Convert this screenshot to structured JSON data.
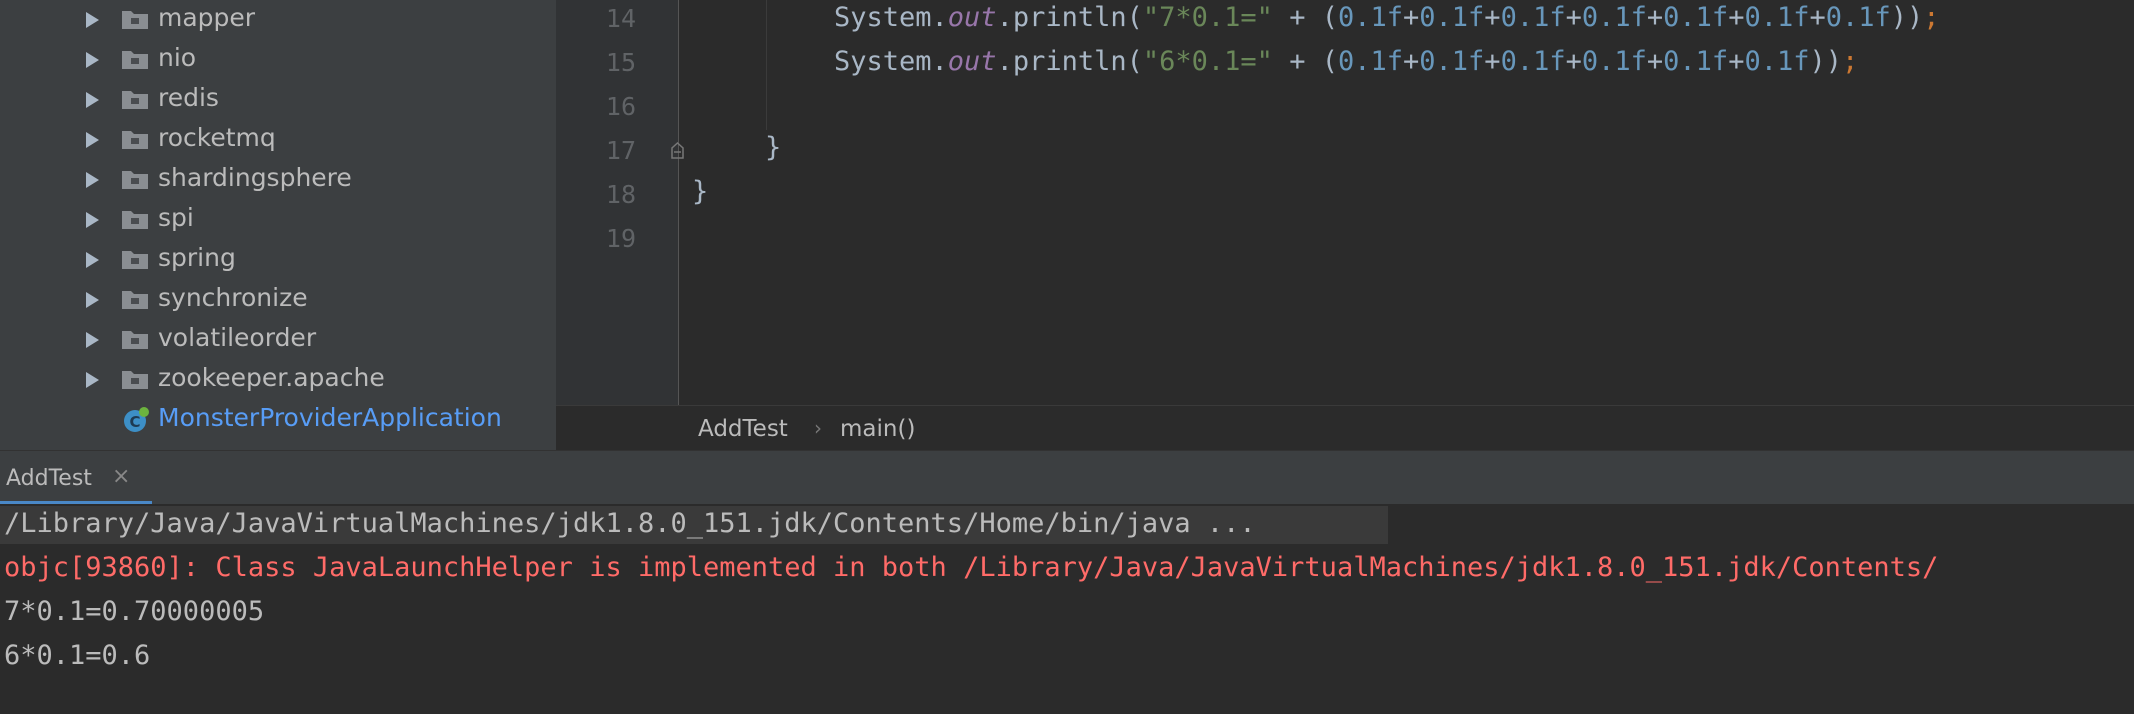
{
  "tree": {
    "folders": [
      "mapper",
      "nio",
      "redis",
      "rocketmq",
      "shardingsphere",
      "spi",
      "spring",
      "synchronize",
      "volatileorder",
      "zookeeper.apache"
    ],
    "app_class": "MonsterProviderApplication"
  },
  "editor": {
    "line_numbers": [
      "14",
      "15",
      "16",
      "17",
      "18",
      "19"
    ],
    "line14": {
      "prefix": "System.",
      "field": "out",
      "call": ".println(",
      "string": "\"7*0.1=\"",
      "plus": " + (",
      "nums": [
        "0.1f",
        "0.1f",
        "0.1f",
        "0.1f",
        "0.1f",
        "0.1f",
        "0.1f"
      ],
      "op": "+",
      "close": "))",
      "semi": ";"
    },
    "line15": {
      "prefix": "System.",
      "field": "out",
      "call": ".println(",
      "string": "\"6*0.1=\"",
      "plus": " + (",
      "nums": [
        "0.1f",
        "0.1f",
        "0.1f",
        "0.1f",
        "0.1f",
        "0.1f"
      ],
      "op": "+",
      "close": "))",
      "semi": ";"
    },
    "line17": "}",
    "line18": "}"
  },
  "breadcrumb": {
    "class_name": "AddTest",
    "separator": "›",
    "method": "main()"
  },
  "run": {
    "tab_label": "AddTest",
    "tab_close": "×",
    "console": {
      "command": "/Library/Java/JavaVirtualMachines/jdk1.8.0_151.jdk/Contents/Home/bin/java ...",
      "warning": "objc[93860]: Class JavaLaunchHelper is implemented in both /Library/Java/JavaVirtualMachines/jdk1.8.0_151.jdk/Contents/",
      "output1": "7*0.1=0.70000005",
      "output2": "6*0.1=0.6"
    }
  },
  "colors": {
    "tree_bg": "#3c3f41",
    "editor_bg": "#2b2b2b",
    "string": "#6a8759",
    "number": "#6897bb",
    "field": "#9876aa",
    "keyword": "#cc7832",
    "error": "#ff6b68",
    "link_class": "#589df6"
  }
}
